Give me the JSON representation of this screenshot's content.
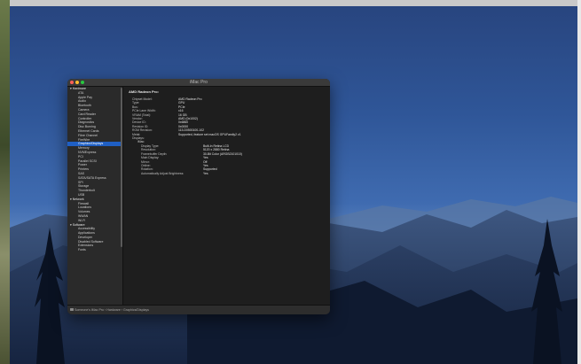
{
  "window": {
    "title": "iMac Pro",
    "traffic_lights": [
      "#ff5f57",
      "#febc2e",
      "#28c840"
    ]
  },
  "sidebar": {
    "items": [
      {
        "label": "▾ Hardware",
        "type": "category"
      },
      {
        "label": "ATA",
        "type": "item"
      },
      {
        "label": "Apple Pay",
        "type": "item"
      },
      {
        "label": "Audio",
        "type": "item"
      },
      {
        "label": "Bluetooth",
        "type": "item"
      },
      {
        "label": "Camera",
        "type": "item"
      },
      {
        "label": "Card Reader",
        "type": "item"
      },
      {
        "label": "Controller",
        "type": "item"
      },
      {
        "label": "Diagnostics",
        "type": "item"
      },
      {
        "label": "Disc Burning",
        "type": "item"
      },
      {
        "label": "Ethernet Cards",
        "type": "item"
      },
      {
        "label": "Fibre Channel",
        "type": "item"
      },
      {
        "label": "FireWire",
        "type": "item"
      },
      {
        "label": "Graphics/Displays",
        "type": "item",
        "selected": true
      },
      {
        "label": "Memory",
        "type": "item"
      },
      {
        "label": "NVMExpress",
        "type": "item"
      },
      {
        "label": "PCI",
        "type": "item"
      },
      {
        "label": "Parallel SCSI",
        "type": "item"
      },
      {
        "label": "Power",
        "type": "item"
      },
      {
        "label": "Printers",
        "type": "item"
      },
      {
        "label": "SAS",
        "type": "item"
      },
      {
        "label": "SATA/SATA Express",
        "type": "item"
      },
      {
        "label": "SPI",
        "type": "item"
      },
      {
        "label": "Storage",
        "type": "item"
      },
      {
        "label": "Thunderbolt",
        "type": "item"
      },
      {
        "label": "USB",
        "type": "item"
      },
      {
        "label": "▾ Network",
        "type": "category"
      },
      {
        "label": "Firewall",
        "type": "item"
      },
      {
        "label": "Locations",
        "type": "item"
      },
      {
        "label": "Volumes",
        "type": "item"
      },
      {
        "label": "WWAN",
        "type": "item"
      },
      {
        "label": "Wi-Fi",
        "type": "item"
      },
      {
        "label": "▾ Software",
        "type": "category"
      },
      {
        "label": "Accessibility",
        "type": "item"
      },
      {
        "label": "Applications",
        "type": "item"
      },
      {
        "label": "Developer",
        "type": "item"
      },
      {
        "label": "Disabled Software",
        "type": "item"
      },
      {
        "label": "Extensions",
        "type": "item"
      },
      {
        "label": "Fonts",
        "type": "item"
      }
    ]
  },
  "content": {
    "heading": "AMD Radeon Pro:",
    "fields": [
      {
        "k": "Chipset Model:",
        "v": "AMD Radeon Pro"
      },
      {
        "k": "Type:",
        "v": "GPU"
      },
      {
        "k": "Bus:",
        "v": "PCIe"
      },
      {
        "k": "PCIe Lane Width:",
        "v": "x16"
      },
      {
        "k": "VRAM (Total):",
        "v": "16 GB"
      },
      {
        "k": "Vendor:",
        "v": "AMD (0x1002)"
      },
      {
        "k": "Device ID:",
        "v": "0x6860"
      },
      {
        "k": "Revision ID:",
        "v": "0x0000"
      },
      {
        "k": "ROM Revision:",
        "v": "113-D0500100-102"
      },
      {
        "k": "Metal:",
        "v": "Supported, feature set macOS GPUFamily2 v1"
      }
    ],
    "displays_label": "Displays:",
    "display_name": "iMac:",
    "display_fields": [
      {
        "k": "Display Type:",
        "v": "Built-In Retina LCD"
      },
      {
        "k": "Resolution:",
        "v": "5120 x 2880 Retina"
      },
      {
        "k": "Framebuffer Depth:",
        "v": "30-Bit Color (ARGB2101010)"
      },
      {
        "k": "Main Display:",
        "v": "Yes"
      },
      {
        "k": "Mirror:",
        "v": "Off"
      },
      {
        "k": "Online:",
        "v": "Yes"
      },
      {
        "k": "Rotation:",
        "v": "Supported"
      },
      {
        "k": "Automatically Adjust Brightness:",
        "v": "Yes"
      }
    ]
  },
  "statusbar": {
    "path": "Someone's iMac Pro › Hardware › Graphics/Displays"
  }
}
